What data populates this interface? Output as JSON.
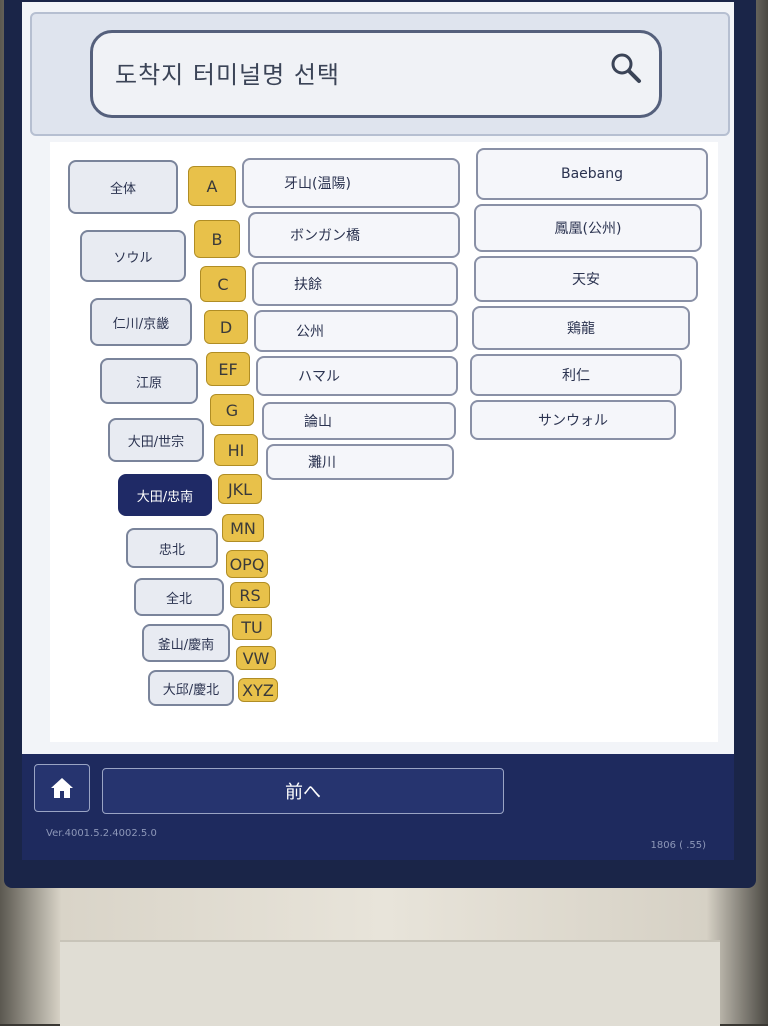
{
  "search": {
    "title": "도착지 터미널명 선택",
    "icon": "search-icon"
  },
  "regions": [
    {
      "label": "全体",
      "active": false
    },
    {
      "label": "ソウル",
      "active": false
    },
    {
      "label": "仁川/京畿",
      "active": false
    },
    {
      "label": "江原",
      "active": false
    },
    {
      "label": "大田/世宗",
      "active": false
    },
    {
      "label": "大田/忠南",
      "active": true
    },
    {
      "label": "忠北",
      "active": false
    },
    {
      "label": "全北",
      "active": false
    },
    {
      "label": "釜山/慶南",
      "active": false
    },
    {
      "label": "大邱/慶北",
      "active": false
    }
  ],
  "alphabet": [
    "A",
    "B",
    "C",
    "D",
    "EF",
    "G",
    "HI",
    "JKL",
    "MN",
    "OPQ",
    "RS",
    "TU",
    "VW",
    "XYZ"
  ],
  "terminals_left": [
    "牙山(温陽)",
    "ボンガン橋",
    "扶餘",
    "公州",
    "ハマル",
    "論山",
    "灘川"
  ],
  "terminals_right": [
    "Baebang",
    "鳳凰(公州)",
    "天安",
    "鶏龍",
    "利仁",
    "サンウォル"
  ],
  "footer": {
    "home_icon": "home-icon",
    "prev_label": "前へ",
    "version": "Ver.4001.5.2.4002.5.0",
    "code": "1806 ( .55)"
  },
  "colors": {
    "accent": "#1f2a66",
    "alpha": "#e8c14a"
  }
}
